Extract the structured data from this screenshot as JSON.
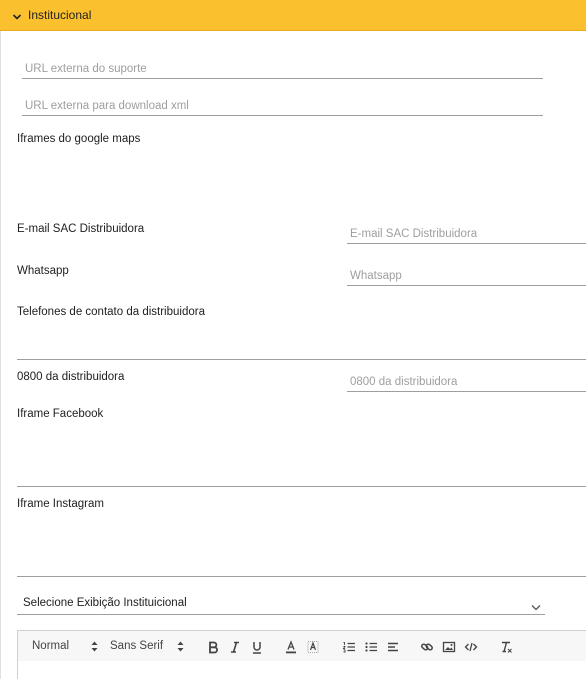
{
  "section": {
    "title": "Institucional",
    "accent_color": "#fbc02d",
    "icon": "chevron-down-icon"
  },
  "fields": {
    "url_suporte": {
      "placeholder": "URL externa do suporte",
      "value": ""
    },
    "url_download_xml": {
      "placeholder": "URL externa para download xml",
      "value": ""
    },
    "iframes_google_maps": {
      "label": "Iframes do google maps"
    },
    "email_sac": {
      "label": "E-mail SAC Distribuidora",
      "placeholder": "E-mail SAC Distribuidora"
    },
    "whatsapp": {
      "label": "Whatsapp",
      "placeholder": "Whatsapp"
    },
    "telefones": {
      "label": "Telefones de contato da distribuidora"
    },
    "tel_0800": {
      "label": "0800 da distribuidora",
      "placeholder": "0800 da distribuidora"
    },
    "iframe_facebook": {
      "label": "Iframe Facebook"
    },
    "iframe_instagram": {
      "label": "Iframe Instagram"
    }
  },
  "exibicao_select": {
    "value": "Selecione Exibição Instituicional",
    "icon": "chevron-down-icon"
  },
  "editor_toolbar": {
    "header_picker": "Normal",
    "font_picker": "Sans Serif",
    "buttons": [
      "bold",
      "italic",
      "underline",
      "text-color",
      "background-color",
      "ordered-list",
      "bullet-list",
      "align",
      "link",
      "image",
      "code-block",
      "clean"
    ]
  }
}
